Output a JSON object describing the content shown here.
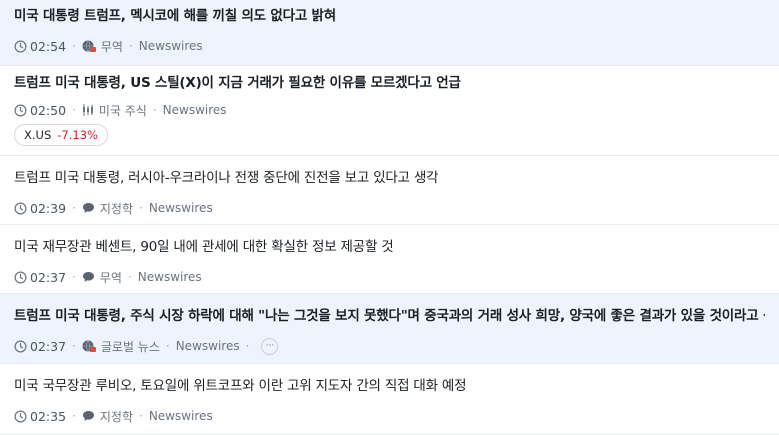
{
  "feed": {
    "items": [
      {
        "title": "미국 대통령 트럼프, 멕시코에 해를 끼칠 의도 없다고 밝혀",
        "time": "02:54",
        "icon": "globe-flag-icon",
        "category": "무역",
        "source": "Newswires"
      },
      {
        "title": "트럼프 미국 대통령, US 스틸(X)이 지금 거래가 필요한 이유를 모르겠다고 언급",
        "time": "02:50",
        "icon": "candlestick-icon",
        "category": "미국 주식",
        "source": "Newswires",
        "ticker": {
          "symbol": "X.US",
          "change": "-7.13%",
          "color": "#d2202f"
        }
      },
      {
        "title": "트럼프 미국 대통령, 러시아-우크라이나 전쟁 중단에 진전을 보고 있다고 생각",
        "time": "02:39",
        "icon": "speech-bubble-icon",
        "category": "지정학",
        "source": "Newswires"
      },
      {
        "title": "미국 재무장관 베센트, 90일 내에 관세에 대한 확실한 정보 제공할 것",
        "time": "02:37",
        "icon": "speech-bubble-icon",
        "category": "무역",
        "source": "Newswires"
      },
      {
        "title": "트럼프 미국 대통령, 주식 시장 하락에 대해 \"나는 그것을 보지 못했다\"며 중국과의 거래 성사 희망, 양국에 좋은 결과가 있을 것이라고 생각",
        "time": "02:37",
        "icon": "globe-flag-icon",
        "category": "글로벌 뉴스",
        "source": "Newswires",
        "more": "···"
      },
      {
        "title": "미국 국무장관 루비오, 토요일에 위트코프와 이란 고위 지도자 간의 직접 대화 예정",
        "time": "02:35",
        "icon": "speech-bubble-icon",
        "category": "지정학",
        "source": "Newswires"
      }
    ]
  }
}
